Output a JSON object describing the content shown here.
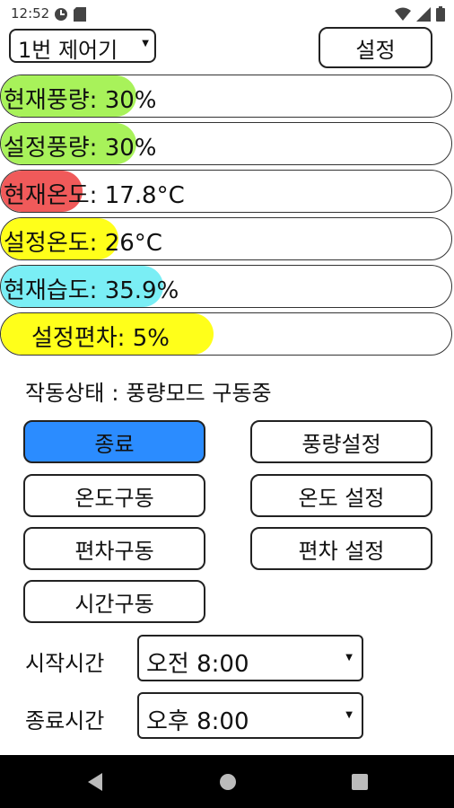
{
  "status_bar": {
    "time": "12:52"
  },
  "controller_select": {
    "value": "1번 제어기"
  },
  "settings_button": {
    "label": "설정"
  },
  "gauges": [
    {
      "text": "현재풍량: 30%",
      "color": "#a8f25a",
      "level_percent": 30
    },
    {
      "text": "설정풍량: 30%",
      "color": "#a8f25a",
      "level_percent": 30
    },
    {
      "text": "현재온도: 17.8°C",
      "color": "#f05a5a",
      "level_percent": 18
    },
    {
      "text": "설정온도: 26°C",
      "color": "#ffff1a",
      "level_percent": 26
    },
    {
      "text": "현재습도: 35.9%",
      "color": "#7aeef5",
      "level_percent": 36
    },
    {
      "text": "설정편차: 5%",
      "color": "#ffff1a",
      "level_percent": 47
    }
  ],
  "operation_status": {
    "label": "작동상태",
    "separator": ":",
    "value": "풍량모드 구동중"
  },
  "buttons": {
    "stop": "종료",
    "airflow_setting": "풍량설정",
    "temp_drive": "온도구동",
    "temp_setting": "온도 설정",
    "deviation_drive": "편차구동",
    "deviation_setting": "편차 설정",
    "time_drive": "시간구동"
  },
  "active_button_color": "#2b8cff",
  "start_time": {
    "label": "시작시간",
    "value": "오전 8:00"
  },
  "end_time": {
    "label": "종료시간",
    "value": "오후 8:00"
  }
}
